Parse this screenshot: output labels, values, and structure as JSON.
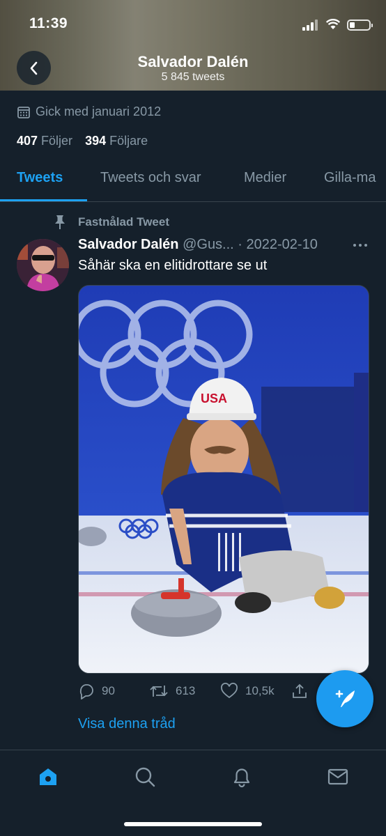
{
  "status_bar": {
    "time": "11:39"
  },
  "header": {
    "profile_name": "Salvador Dalén",
    "tweet_count": "5 845 tweets"
  },
  "profile": {
    "joined": "Gick med januari 2012",
    "following_count": "407",
    "following_label": "Följer",
    "followers_count": "394",
    "followers_label": "Följare"
  },
  "tabs": [
    {
      "label": "Tweets",
      "active": true
    },
    {
      "label": "Tweets och svar",
      "active": false
    },
    {
      "label": "Medier",
      "active": false
    },
    {
      "label": "Gilla-ma",
      "active": false
    }
  ],
  "tweet": {
    "pinned_label": "Fastnålad Tweet",
    "author_name": "Salvador Dalén",
    "handle": "@Gus...",
    "date": "· 2022-02-10",
    "text": "Såhär ska en elitidrottare se ut",
    "replies": "90",
    "retweets": "613",
    "likes": "10,5k",
    "thread_link": "Visa denna tråd"
  },
  "colors": {
    "background": "#15202b",
    "accent": "#1da1f2",
    "muted": "#8899a6",
    "divider": "#38444d"
  },
  "icons": {
    "back": "chevron-left-icon",
    "calendar": "calendar-icon",
    "pin": "pin-icon",
    "more": "more-dots-icon",
    "reply": "reply-icon",
    "retweet": "retweet-icon",
    "like": "heart-icon",
    "share": "share-icon",
    "compose": "compose-tweet-icon",
    "home": "home-icon",
    "search": "search-icon",
    "notifications": "bell-icon",
    "messages": "mail-icon"
  }
}
